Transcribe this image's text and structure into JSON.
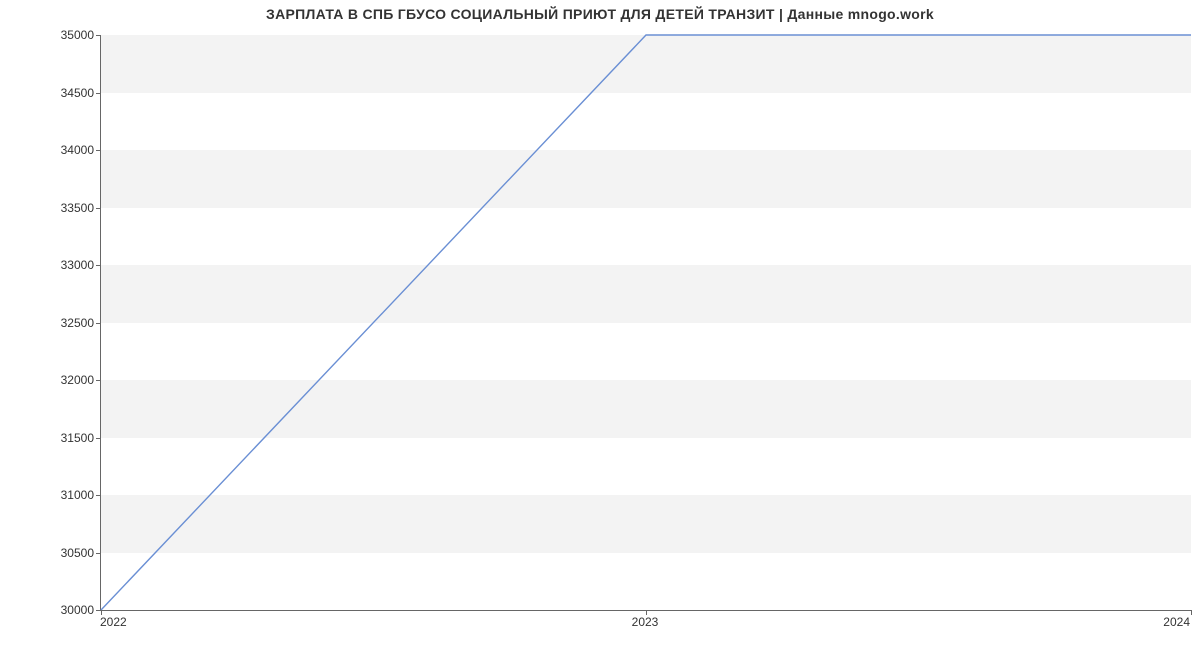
{
  "chart_data": {
    "type": "line",
    "title": "ЗАРПЛАТА В СПБ ГБУСО СОЦИАЛЬНЫЙ ПРИЮТ ДЛЯ ДЕТЕЙ ТРАНЗИТ | Данные mnogo.work",
    "x": [
      2022,
      2023,
      2024
    ],
    "y": [
      30000,
      35000,
      35000
    ],
    "x_ticks": [
      "2022",
      "2023",
      "2024"
    ],
    "y_ticks": [
      30000,
      30500,
      31000,
      31500,
      32000,
      32500,
      33000,
      33500,
      34000,
      34500,
      35000
    ],
    "xlim": [
      2022,
      2024
    ],
    "ylim": [
      30000,
      35000
    ],
    "line_color": "#6a8fd4"
  }
}
